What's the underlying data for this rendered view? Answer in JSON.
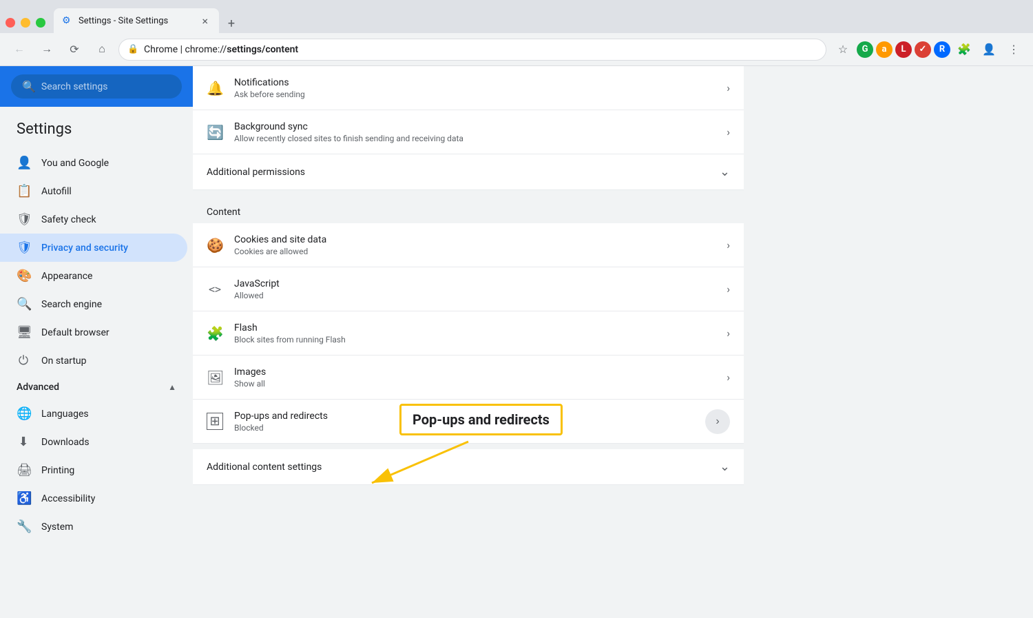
{
  "browser": {
    "tab_title": "Settings - Site Settings",
    "tab_icon": "⚙",
    "new_tab_icon": "+",
    "close_icon": "×"
  },
  "toolbar": {
    "back_title": "Back",
    "forward_title": "Forward",
    "reload_title": "Reload",
    "home_title": "Home",
    "address_prefix": "Chrome",
    "address_url": "chrome://settings/content",
    "star_title": "Bookmark",
    "menu_title": "Menu"
  },
  "search": {
    "placeholder": "Search settings"
  },
  "sidebar": {
    "title": "Settings",
    "items": [
      {
        "id": "you-and-google",
        "label": "You and Google",
        "icon": "👤"
      },
      {
        "id": "autofill",
        "label": "Autofill",
        "icon": "📋"
      },
      {
        "id": "safety-check",
        "label": "Safety check",
        "icon": "🛡"
      },
      {
        "id": "privacy-and-security",
        "label": "Privacy and security",
        "icon": "🛡",
        "active": true
      },
      {
        "id": "appearance",
        "label": "Appearance",
        "icon": "🎨"
      },
      {
        "id": "search-engine",
        "label": "Search engine",
        "icon": "🔍"
      },
      {
        "id": "default-browser",
        "label": "Default browser",
        "icon": "🖥"
      },
      {
        "id": "on-startup",
        "label": "On startup",
        "icon": "⏻"
      }
    ],
    "advanced_section": {
      "label": "Advanced",
      "expanded": true,
      "items": [
        {
          "id": "languages",
          "label": "Languages",
          "icon": "🌐"
        },
        {
          "id": "downloads",
          "label": "Downloads",
          "icon": "⬇"
        },
        {
          "id": "printing",
          "label": "Printing",
          "icon": "🖨"
        },
        {
          "id": "accessibility",
          "label": "Accessibility",
          "icon": "♿"
        },
        {
          "id": "system",
          "label": "System",
          "icon": "🔧"
        }
      ]
    }
  },
  "content": {
    "rows": [
      {
        "id": "notifications",
        "icon": "🔔",
        "title": "Notifications",
        "subtitle": "Ask before sending"
      },
      {
        "id": "background-sync",
        "icon": "🔄",
        "title": "Background sync",
        "subtitle": "Allow recently closed sites to finish sending and receiving data"
      }
    ],
    "additional_permissions": {
      "label": "Additional permissions",
      "expanded": false
    },
    "content_section_label": "Content",
    "content_rows": [
      {
        "id": "cookies",
        "icon": "🍪",
        "title": "Cookies and site data",
        "subtitle": "Cookies are allowed"
      },
      {
        "id": "javascript",
        "icon": "<>",
        "title": "JavaScript",
        "subtitle": "Allowed"
      },
      {
        "id": "flash",
        "icon": "🧩",
        "title": "Flash",
        "subtitle": "Block sites from running Flash"
      },
      {
        "id": "images",
        "icon": "🖼",
        "title": "Images",
        "subtitle": "Show all"
      },
      {
        "id": "popups",
        "icon": "⊞",
        "title": "Pop-ups and redirects",
        "subtitle": "Blocked",
        "highlighted": true
      }
    ],
    "additional_content_settings": {
      "label": "Additional content settings",
      "expanded": false
    }
  },
  "annotation": {
    "label": "Pop-ups and redirects"
  }
}
